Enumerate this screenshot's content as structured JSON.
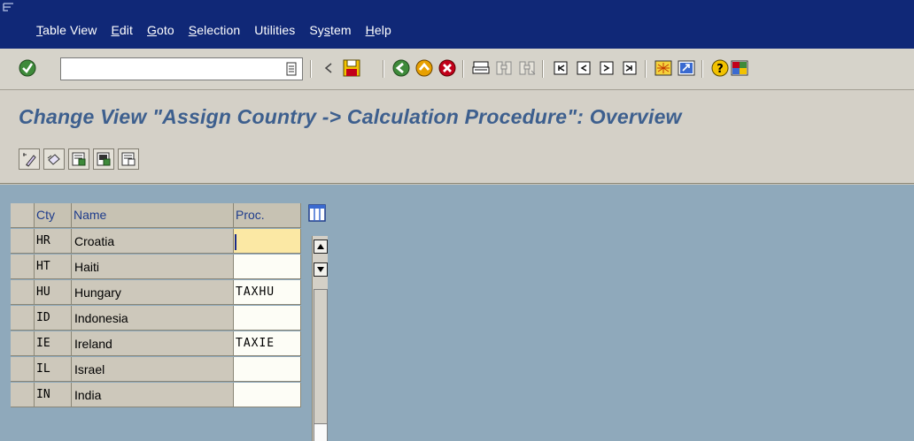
{
  "menu": {
    "items": [
      {
        "underline": "T",
        "rest": "able View"
      },
      {
        "underline": "E",
        "rest": "dit"
      },
      {
        "underline": "G",
        "rest": "oto"
      },
      {
        "underline": "S",
        "rest": "election"
      },
      {
        "underline": "",
        "rest": "Utilities"
      },
      {
        "underline": "",
        "rest": "Sy",
        "underline2": "s",
        "rest2": "tem"
      },
      {
        "underline": "H",
        "rest": "elp"
      }
    ]
  },
  "toolbar": {
    "okcode_value": "",
    "icons": [
      "enter-icon",
      "okcode-history-icon",
      "back-arrow-icon",
      "save-icon",
      "back-icon",
      "exit-icon",
      "cancel-icon",
      "print-icon",
      "find-icon",
      "find-next-icon",
      "first-page-icon",
      "previous-page-icon",
      "next-page-icon",
      "last-page-icon",
      "create-session-icon",
      "shortcut-icon",
      "help-icon",
      "layout-menu-icon"
    ]
  },
  "page": {
    "title": "Change View \"Assign Country -> Calculation Procedure\": Overview"
  },
  "app_toolbar": {
    "icons": [
      "display-change-icon",
      "undo-icon",
      "select-all-icon",
      "select-block-icon",
      "deselect-all-icon"
    ]
  },
  "table": {
    "headers": {
      "cty": "Cty",
      "name": "Name",
      "proc": "Proc."
    },
    "rows": [
      {
        "cty": "HR",
        "name": "Croatia",
        "proc": ""
      },
      {
        "cty": "HT",
        "name": "Haiti",
        "proc": ""
      },
      {
        "cty": "HU",
        "name": "Hungary",
        "proc": "TAXHU"
      },
      {
        "cty": "ID",
        "name": "Indonesia",
        "proc": ""
      },
      {
        "cty": "IE",
        "name": "Ireland",
        "proc": "TAXIE"
      },
      {
        "cty": "IL",
        "name": "Israel",
        "proc": ""
      },
      {
        "cty": "IN",
        "name": "India",
        "proc": ""
      }
    ]
  },
  "colors": {
    "menubar": "#102877",
    "title": "#3d5f8e",
    "workarea": "#8fa9bb",
    "focus_cell": "#fbe8a4"
  }
}
